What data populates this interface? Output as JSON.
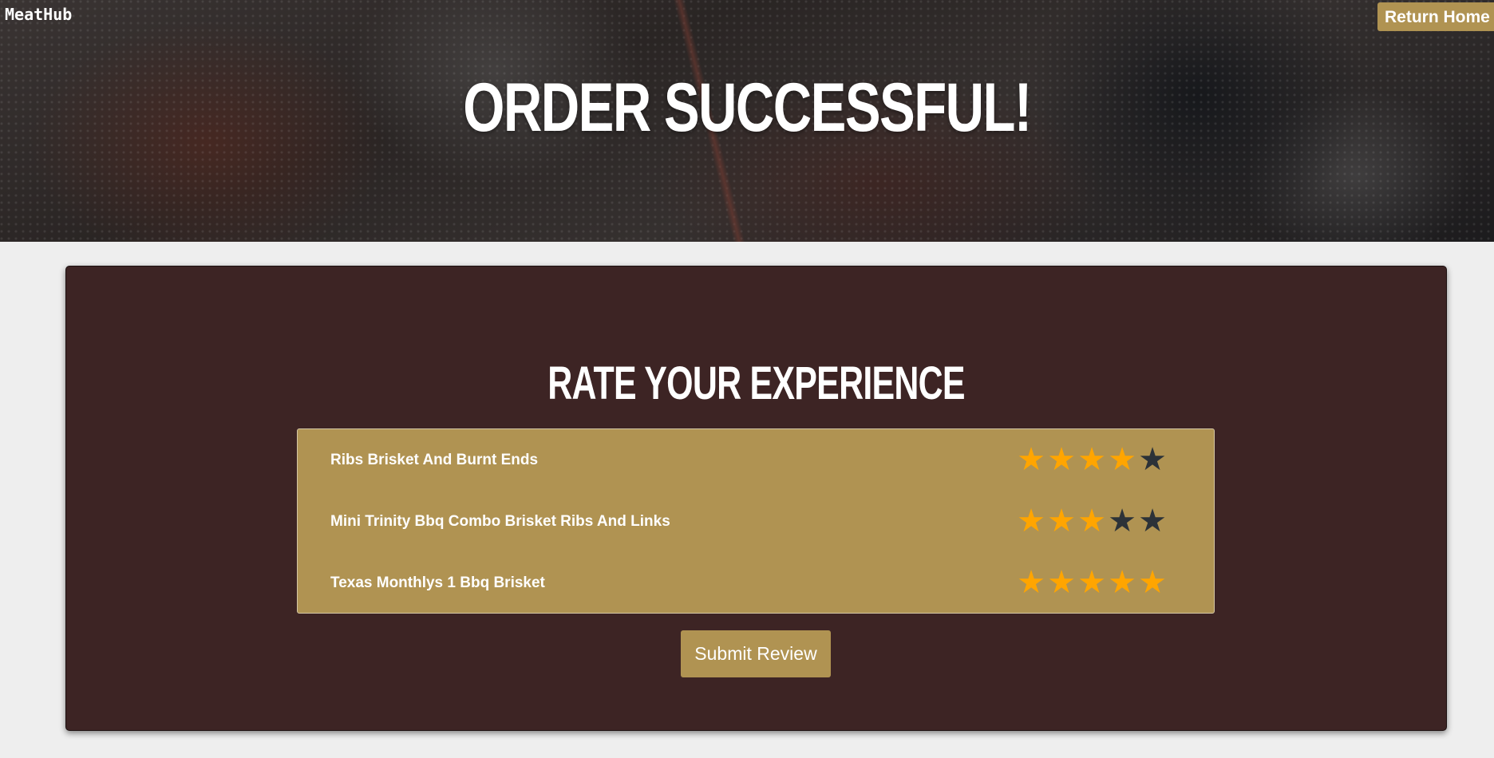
{
  "header": {
    "brand": "MeatHub",
    "return_label": "Return Home",
    "title": "ORDER SUCCESSFUL!"
  },
  "review": {
    "title": "RATE YOUR EXPERIENCE",
    "max_stars": 5,
    "items": [
      {
        "name": "Ribs Brisket And Burnt Ends",
        "rating": 4
      },
      {
        "name": "Mini Trinity Bbq Combo Brisket Ribs And Links",
        "rating": 3
      },
      {
        "name": "Texas Monthlys 1 Bbq Brisket",
        "rating": 5
      }
    ],
    "submit_label": "Submit Review"
  },
  "icons": {
    "star": "star-icon"
  },
  "colors": {
    "accent": "#b09352",
    "panel": "#3d2424",
    "star_active": "#ffa500",
    "star_inactive": "#2c3238",
    "page_background": "#eeeeee"
  }
}
